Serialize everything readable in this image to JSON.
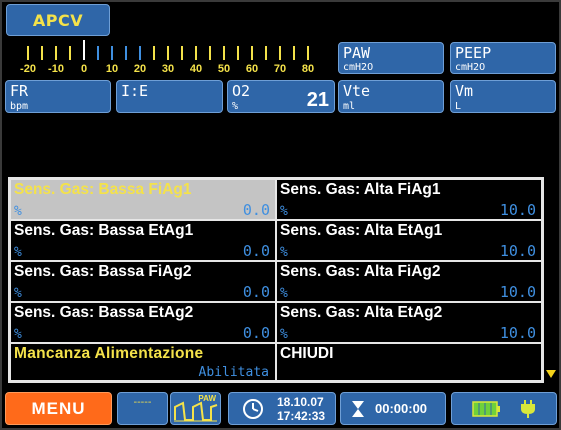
{
  "mode": "APCV",
  "scale": {
    "labels": [
      "-20",
      "-10",
      "0",
      "10",
      "20",
      "30",
      "40",
      "50",
      "60",
      "70",
      "80"
    ]
  },
  "params": {
    "paw": {
      "name": "PAW",
      "unit": "cmH2O"
    },
    "peep": {
      "name": "PEEP",
      "unit": "cmH2O"
    },
    "fr": {
      "name": "FR",
      "unit": "bpm"
    },
    "ie": {
      "name": "I:E"
    },
    "o2": {
      "name": "O2",
      "unit": "%",
      "value": "21"
    },
    "vte": {
      "name": "Vte",
      "unit": "ml"
    },
    "vm": {
      "name": "Vm",
      "unit": "L"
    }
  },
  "alarms": [
    {
      "label": "Sens. Gas: Bassa FiAg1",
      "unit": "%",
      "value": "0.0"
    },
    {
      "label": "Sens. Gas: Alta FiAg1",
      "unit": "%",
      "value": "10.0"
    },
    {
      "label": "Sens. Gas: Bassa EtAg1",
      "unit": "%",
      "value": "0.0"
    },
    {
      "label": "Sens. Gas: Alta EtAg1",
      "unit": "%",
      "value": "10.0"
    },
    {
      "label": "Sens. Gas: Bassa FiAg2",
      "unit": "%",
      "value": "0.0"
    },
    {
      "label": "Sens. Gas: Alta FiAg2",
      "unit": "%",
      "value": "10.0"
    },
    {
      "label": "Sens. Gas: Bassa EtAg2",
      "unit": "%",
      "value": "0.0"
    },
    {
      "label": "Sens. Gas: Alta EtAg2",
      "unit": "%",
      "value": "10.0"
    }
  ],
  "power_failure": {
    "label": "Mancanza Alimentazione",
    "status": "Abilitata"
  },
  "close_label": "CHIUDI",
  "bottom": {
    "menu": "MENU",
    "dashes": "-----",
    "paw_label": "PAW",
    "date": "18.10.07",
    "time": "17:42:33",
    "timer": "00:00:00"
  },
  "colors": {
    "accent": "#2f66a8",
    "menu": "#ff6a1a",
    "label_yellow": "#f4e24a",
    "value_blue": "#3f8fe0"
  }
}
